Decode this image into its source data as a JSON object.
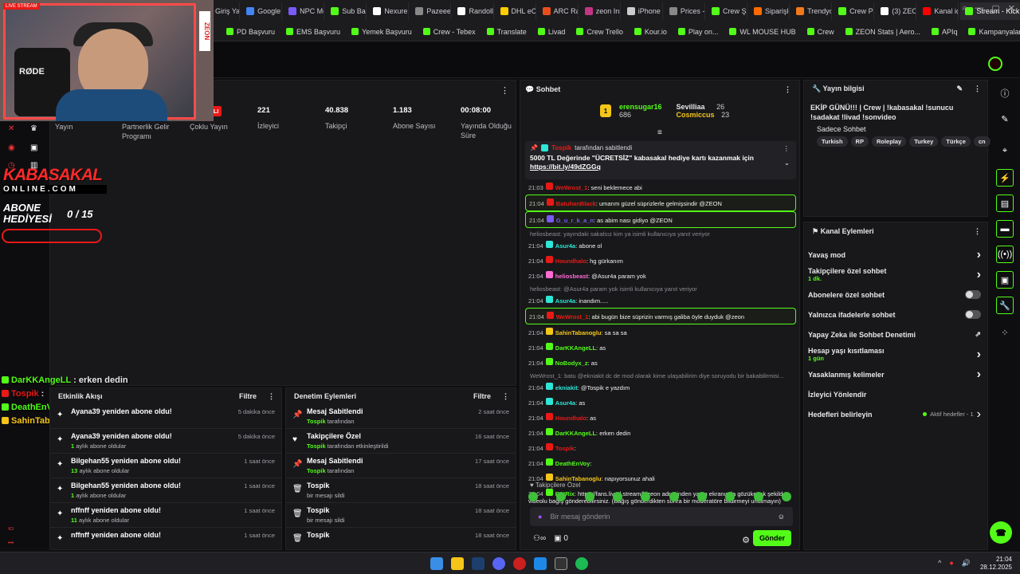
{
  "browser": {
    "tabs": [
      {
        "label": "Giriş Yap",
        "color": "#2b7de9"
      },
      {
        "label": "Google G",
        "color": "#4285f4"
      },
      {
        "label": "NPC Mo",
        "color": "#7a5af8"
      },
      {
        "label": "Sub Bad",
        "color": "#53fc18"
      },
      {
        "label": "Nexure -",
        "color": "#ffffff"
      },
      {
        "label": "Pazeee -",
        "color": "#888888"
      },
      {
        "label": "Randollo",
        "color": "#ffffff"
      },
      {
        "label": "DHL eCo",
        "color": "#ffcc00"
      },
      {
        "label": "ARC Raid",
        "color": "#e94e1b"
      },
      {
        "label": "zeon Inst",
        "color": "#c13584"
      },
      {
        "label": "iPhone 16",
        "color": "#cccccc"
      },
      {
        "label": "Prices - A",
        "color": "#888888"
      },
      {
        "label": "Crew Şik",
        "color": "#53fc18"
      },
      {
        "label": "Siparişle",
        "color": "#ff6a00"
      },
      {
        "label": "Trendyol",
        "color": "#f27a1a"
      },
      {
        "label": "Crew PD",
        "color": "#53fc18"
      },
      {
        "label": "(3) ZEON",
        "color": "#ffffff"
      },
      {
        "label": "Kanal içe",
        "color": "#ff0000"
      },
      {
        "label": "Stream - Kick Das",
        "color": "#53fc18",
        "active": true
      }
    ],
    "bookmarks": [
      "PD Başvuru",
      "EMS Başvuru",
      "Yemek Başvuru",
      "Crew - Tebex",
      "Translate",
      "Livad",
      "Crew Trello",
      "Kour.io",
      "Play on...",
      "WL MOUSE HUB",
      "Crew",
      "ZEON Stats | Aero...",
      "APIq",
      "Kampanyalar"
    ]
  },
  "webcam": {
    "brand": "RØDE",
    "sidebrand": "ZEON",
    "live": "LIVE STREAM"
  },
  "overlay": {
    "brand": "KABASAKAL",
    "site": "ONLINE.COM",
    "gift_label": "ABONE HEDİYESİ",
    "gift_count": "0 / 15"
  },
  "stats": {
    "badge": "KAPALI",
    "items": [
      {
        "label": "Yayın",
        "value": ""
      },
      {
        "label": "Partnerlik Gelir Programı",
        "value": ""
      },
      {
        "label": "Çoklu Yayın",
        "value": ""
      },
      {
        "label": "İzleyici",
        "value": "221"
      },
      {
        "label": "Takipçi",
        "value": "40.838"
      },
      {
        "label": "Abone Sayısı",
        "value": "1.183"
      },
      {
        "label": "Yayında Olduğu Süre",
        "value": "00:08:00"
      }
    ]
  },
  "float_chat": [
    {
      "name": "DarKKAngeLL",
      "text": ": erken dedin",
      "color": "#53fc18"
    },
    {
      "name": "Tospik",
      "text": ":",
      "color": "#e91916"
    },
    {
      "name": "DeathEnVoy",
      "text": ":",
      "color": "#53fc18"
    },
    {
      "name": "SahinTabanoglu",
      "text": ": napıyorsunuz ahali",
      "color": "#f5c518"
    }
  ],
  "activity": {
    "title": "Etkinlik Akışı",
    "filter": "Filtre",
    "items": [
      {
        "title": "Ayana39 yeniden abone oldu!",
        "sub_num": "",
        "sub": "",
        "time": "5 dakika önce"
      },
      {
        "title": "Ayana39 yeniden abone oldu!",
        "sub_num": "1",
        "sub": "aylık abone oldular",
        "time": "5 dakika önce"
      },
      {
        "title": "Bilgehan55 yeniden abone oldu!",
        "sub_num": "13",
        "sub": "aylık abone oldular",
        "time": "1 saat önce"
      },
      {
        "title": "Bilgehan55 yeniden abone oldu!",
        "sub_num": "1",
        "sub": "aylık abone oldular",
        "time": "1 saat önce"
      },
      {
        "title": "nffnff yeniden abone oldu!",
        "sub_num": "11",
        "sub": "aylık abone oldular",
        "time": "1 saat önce"
      },
      {
        "title": "nffnff yeniden abone oldu!",
        "sub_num": "",
        "sub": "",
        "time": "1 saat önce"
      }
    ]
  },
  "moderation": {
    "title": "Denetim Eylemleri",
    "filter": "Filtre",
    "items": [
      {
        "title": "Mesaj Sabitlendi",
        "who": "Tospik",
        "sub": "tarafından",
        "time": "2 saat önce",
        "icon": "pin"
      },
      {
        "title": "Takipçilere Özel",
        "who": "Tospik",
        "sub": "tarafından etkinleştirildi",
        "time": "16 saat önce",
        "icon": "heart"
      },
      {
        "title": "Mesaj Sabitlendi",
        "who": "Tospik",
        "sub": "tarafından",
        "time": "17 saat önce",
        "icon": "pin"
      },
      {
        "title": "Tospik",
        "who": "",
        "sub": "bir mesajı sildi",
        "time": "18 saat önce",
        "icon": "trash"
      },
      {
        "title": "Tospik",
        "who": "",
        "sub": "bir mesajı sildi",
        "time": "18 saat önce",
        "icon": "trash"
      },
      {
        "title": "Tospik",
        "who": "",
        "sub": "",
        "time": "18 saat önce",
        "icon": "trash"
      }
    ]
  },
  "chat": {
    "title": "Sohbet",
    "leaders": [
      {
        "rank": "1",
        "name": "erensugar16",
        "count": "686",
        "color": "#53fc18"
      },
      {
        "name": "Sevilliaa",
        "count": "26",
        "color": "#fff"
      },
      {
        "name": "Cosmiccus",
        "count": "23",
        "color": "#f5c518"
      }
    ],
    "pinned_by": "Tospik",
    "pinned_suffix": "tarafından sabitlendi",
    "pinned_msg": "5000 TL Değerinde \"ÜCRETSİZ\" kabasakal hediye kartı kazanmak için",
    "pinned_link": "https://bit.ly/49dZGGq",
    "lines": [
      {
        "time": "21:04",
        "name": "SahinTabanoglu",
        "color": "#f5c518",
        "text": "sa sa sa"
      },
      {
        "time": "21:04",
        "name": "DarKKAngeLL",
        "color": "#53fc18",
        "text": "as"
      },
      {
        "time": "21:04",
        "name": "NoBodyx_z",
        "color": "#53fc18",
        "text": "as"
      },
      {
        "reply": "WeWrost_1: batu @ekniakit dc de mod olarak kime ulaşabilirim diye soruyodu bir bakabilirmisi..."
      },
      {
        "time": "21:04",
        "name": "ekniakit",
        "color": "#2ee6d6",
        "text": "@Tospik e yazdım"
      },
      {
        "time": "21:04",
        "name": "Asur4a",
        "color": "#2ee6d6",
        "text": "as"
      },
      {
        "time": "21:04",
        "name": "Houndhalo",
        "color": "#e91916",
        "text": "as"
      },
      {
        "time": "21:04",
        "name": "DarKKAngeLL",
        "color": "#53fc18",
        "text": "erken dedin"
      },
      {
        "time": "21:04",
        "name": "Tospik",
        "color": "#e91916",
        "text": ""
      },
      {
        "time": "21:04",
        "name": "DeathEnVoy",
        "color": "#53fc18",
        "text": ""
      },
      {
        "time": "21:04",
        "name": "SahinTabanoglu",
        "color": "#f5c518",
        "text": "napıyorsunuz ahali"
      },
      {
        "time": "21:04",
        "name": "BotRix",
        "color": "#53fc18",
        "text": "https://fans.livad.stream/k/zeon adresinden yayın ekranında gözükecek şekilde videolu bağış gönderebilirsiniz. (Bağış gönderdikten sonra bir moderatöre bildirmeyi unutmayın)"
      }
    ],
    "upper_lines": [
      {
        "time": "21:03",
        "name": "WeWrost_1",
        "color": "#e91916",
        "text": "seni beklemece abi"
      },
      {
        "time": "21:04",
        "name": "BatuhanBlack",
        "color": "#e91916",
        "text": "umarım güzel süprizlerle gelmişsindir @ZEON",
        "hl": true
      },
      {
        "time": "21:04",
        "name": "G_u_r_k_a_n",
        "color": "#7a5af8",
        "text": "as abim nası gidiyo @ZEON",
        "hl": true
      },
      {
        "reply": "heliosbeast: yayındaki sakalsız kim ya isimli kullanıcıya yanıt veriyor"
      },
      {
        "time": "21:04",
        "name": "Asur4a",
        "color": "#2ee6d6",
        "text": "abone ol"
      },
      {
        "time": "21:04",
        "name": "Houndhalo",
        "color": "#e91916",
        "text": "hg gürkanım"
      },
      {
        "time": "21:04",
        "name": "heliosbeast",
        "color": "#ff6ad5",
        "text": "@Asur4a param yok"
      },
      {
        "reply": "heliosbeast: @Asur4a param yok isimli kullanıcıya yanıt veriyor"
      },
      {
        "time": "21:04",
        "name": "Asur4a",
        "color": "#2ee6d6",
        "text": "inandım....."
      },
      {
        "time": "21:04",
        "name": "WeWrost_1",
        "color": "#e91916",
        "text": "abi bugün bize süprizin varmış galiba öyle duyduk @zeon",
        "hl": true
      }
    ],
    "followers_only": "Takipçilere Özel",
    "placeholder": "Bir mesaj gönderin",
    "counter": "0",
    "send": "Gönder"
  },
  "stream_info": {
    "title": "Yayın bilgisi",
    "stream_title": "EKİP GÜNÜ!!! | Crew | !kabasakal !sunucu !sadakat !livad !sonvideo",
    "category": "Sadece Sohbet",
    "tags": [
      "Turkish",
      "RP",
      "Roleplay",
      "Turkey",
      "Türkçe",
      "cn"
    ]
  },
  "channel_actions": {
    "title": "Kanal Eylemleri",
    "items": [
      {
        "label": "Yavaş mod",
        "sub": "",
        "control": "arrow"
      },
      {
        "label": "Takipçilere özel sohbet",
        "sub": "1 dk.",
        "control": "arrow"
      },
      {
        "label": "Abonelere özel sohbet",
        "sub": "",
        "control": "toggle"
      },
      {
        "label": "Yalnızca ifadelerle sohbet",
        "sub": "",
        "control": "toggle"
      },
      {
        "label": "Yapay Zeka ile Sohbet Denetimi",
        "sub": "",
        "control": "ext"
      },
      {
        "label": "Hesap yaşı kısıtlaması",
        "sub": "1 gün",
        "control": "arrow"
      },
      {
        "label": "Yasaklanmış kelimeler",
        "sub": "",
        "control": "arrow"
      },
      {
        "label": "İzleyici Yönlendir",
        "sub": "",
        "control": ""
      },
      {
        "label": "Hedefleri belirleyin",
        "sub": "",
        "control": "goal",
        "extra": "Aktif hedefler - 1"
      }
    ]
  },
  "taskbar": {
    "time": "21:04",
    "date": "28.12.2025"
  }
}
